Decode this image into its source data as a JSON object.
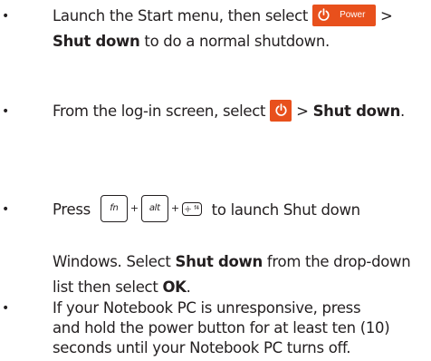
{
  "bullet_char": "•",
  "items": [
    {
      "line1_pre": "Launch the Start menu, then select ",
      "power_button_label": "Power",
      "line1_post": " >",
      "line2_bold": "Shut down",
      "line2_rest": " to do a normal shutdown."
    },
    {
      "pre": "From the log-in screen, select ",
      "mid": " > ",
      "bold": "Shut down",
      "post": "."
    },
    {
      "press": "Press",
      "key_fn": "fn",
      "plus": "+",
      "key_alt": "alt",
      "key_f4_label": "f4",
      "after_keys": " to launch Shut down",
      "line2": "Windows. Select ",
      "line2_bold": "Shut down",
      "line2_rest": " from the drop-down",
      "line3": "list then select ",
      "line3_bold": "OK",
      "line3_rest": "."
    },
    {
      "line1": "If your Notebook PC is unresponsive, press",
      "line2": "and hold the power button for at least ten (10)",
      "line3": "seconds until your Notebook PC turns off."
    }
  ],
  "colors": {
    "accent_button": "#e8501c",
    "text": "#231f20"
  },
  "icons": [
    "power-icon",
    "sun-brightness-icon"
  ]
}
